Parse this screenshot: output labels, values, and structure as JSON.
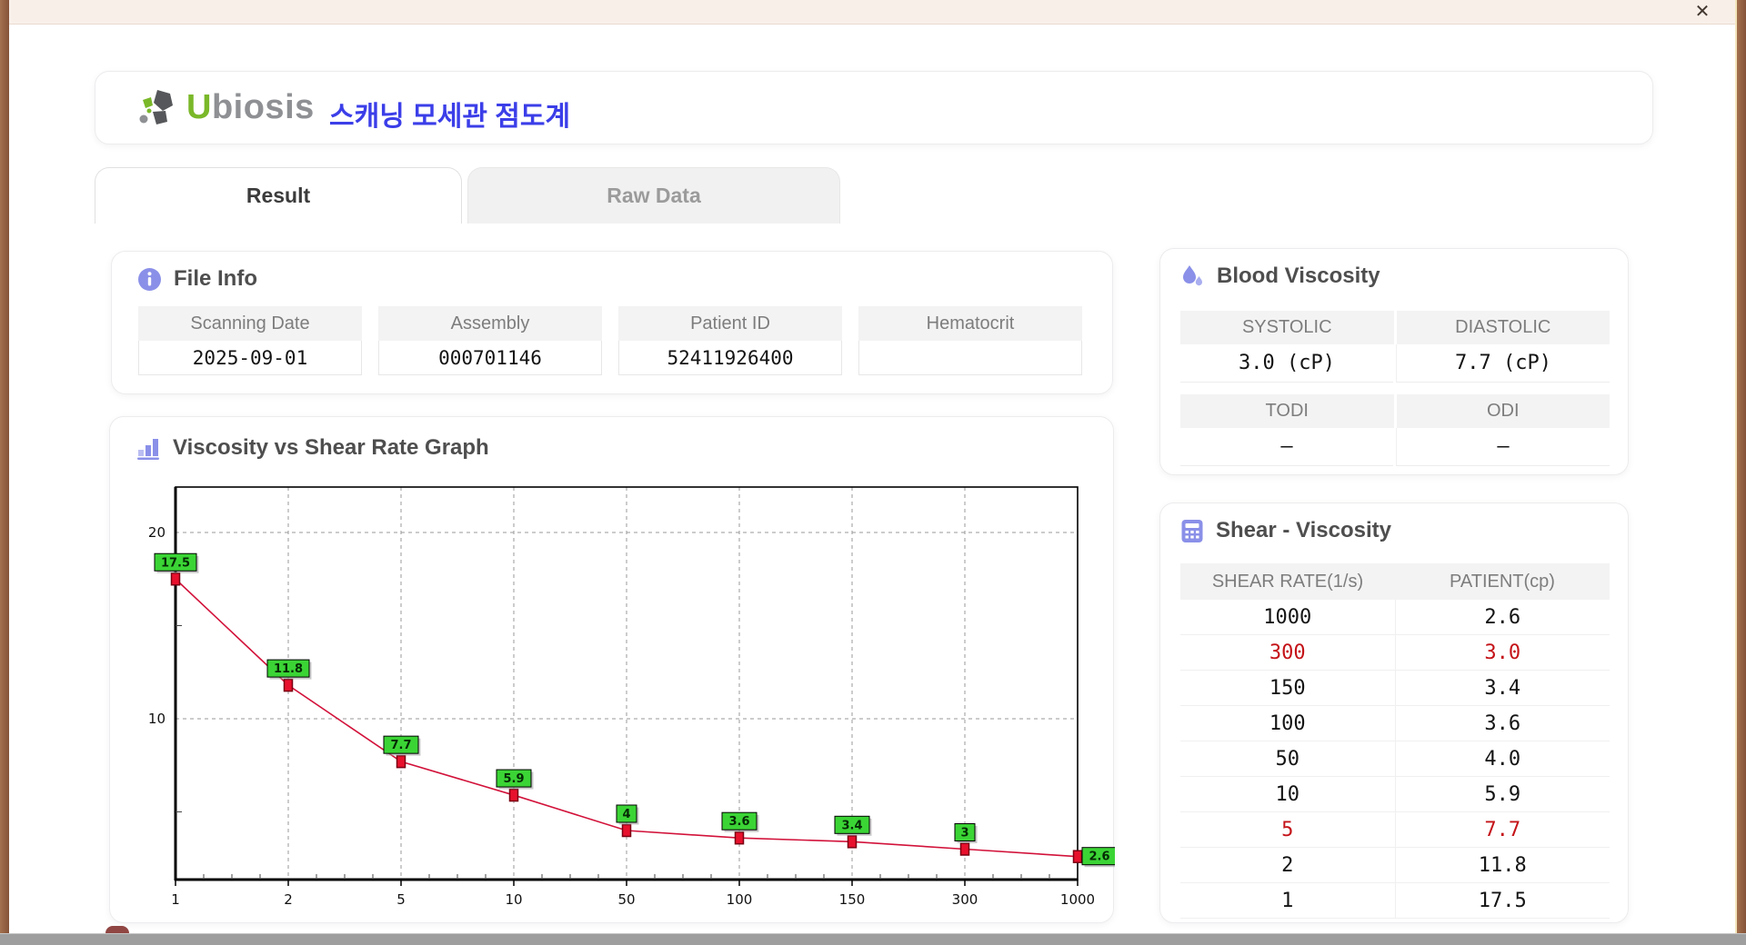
{
  "window": {
    "close_label": "✕"
  },
  "header": {
    "logo": {
      "brand_u": "U",
      "brand_rest": "biosis"
    },
    "app_title": "스캐닝 모세관 점도계"
  },
  "tabs": {
    "result": "Result",
    "raw_data": "Raw Data"
  },
  "file_info": {
    "title": "File Info",
    "fields": [
      {
        "label": "Scanning Date",
        "value": "2025-09-01"
      },
      {
        "label": "Assembly",
        "value": "000701146"
      },
      {
        "label": "Patient ID",
        "value": "52411926400"
      },
      {
        "label": "Hematocrit",
        "value": ""
      }
    ]
  },
  "chart_data": {
    "type": "line",
    "title": "Viscosity vs Shear Rate Graph",
    "xlabel": "",
    "ylabel": "",
    "x_categories": [
      "1",
      "2",
      "5",
      "10",
      "50",
      "100",
      "150",
      "300",
      "1000"
    ],
    "values": [
      17.5,
      11.8,
      7.7,
      5.9,
      4,
      3.6,
      3.4,
      3,
      2.6
    ],
    "point_labels": [
      "17.5",
      "11.8",
      "7.7",
      "5.9",
      "4",
      "3.6",
      "3.4",
      "3",
      "2.6"
    ],
    "y_ticks": [
      10,
      20
    ],
    "y_axis_range": [
      1.4,
      22.4
    ],
    "x_axis_note": "log-valued categories, evenly spaced",
    "grid": true,
    "legend": "none",
    "line_color": "#d2123a",
    "marker_color": "#e8112d",
    "marker_border_color": "#7a0012",
    "point_label_bg": "#3bd435",
    "grid_color": "#999999"
  },
  "blood_viscosity": {
    "title": "Blood Viscosity",
    "groups": [
      [
        {
          "label": "SYSTOLIC",
          "value": "3.0 (cP)"
        },
        {
          "label": "DIASTOLIC",
          "value": "7.7 (cP)"
        }
      ],
      [
        {
          "label": "TODI",
          "value": "–"
        },
        {
          "label": "ODI",
          "value": "–"
        }
      ]
    ]
  },
  "shear_viscosity": {
    "title": "Shear - Viscosity",
    "columns": [
      "SHEAR RATE(1/s)",
      "PATIENT(cp)"
    ],
    "rows": [
      {
        "shear_rate": "1000",
        "patient": "2.6",
        "highlight": false
      },
      {
        "shear_rate": "300",
        "patient": "3.0",
        "highlight": true
      },
      {
        "shear_rate": "150",
        "patient": "3.4",
        "highlight": false
      },
      {
        "shear_rate": "100",
        "patient": "3.6",
        "highlight": false
      },
      {
        "shear_rate": "50",
        "patient": "4.0",
        "highlight": false
      },
      {
        "shear_rate": "10",
        "patient": "5.9",
        "highlight": false
      },
      {
        "shear_rate": "5",
        "patient": "7.7",
        "highlight": true
      },
      {
        "shear_rate": "2",
        "patient": "11.8",
        "highlight": false
      },
      {
        "shear_rate": "1",
        "patient": "17.5",
        "highlight": false
      }
    ]
  },
  "colors": {
    "accent_blue": "#3b3ee8",
    "icon_purple": "#8a90e8",
    "logo_green": "#7ab829",
    "logo_gray": "#8e9093",
    "highlight_red": "#c41318"
  }
}
